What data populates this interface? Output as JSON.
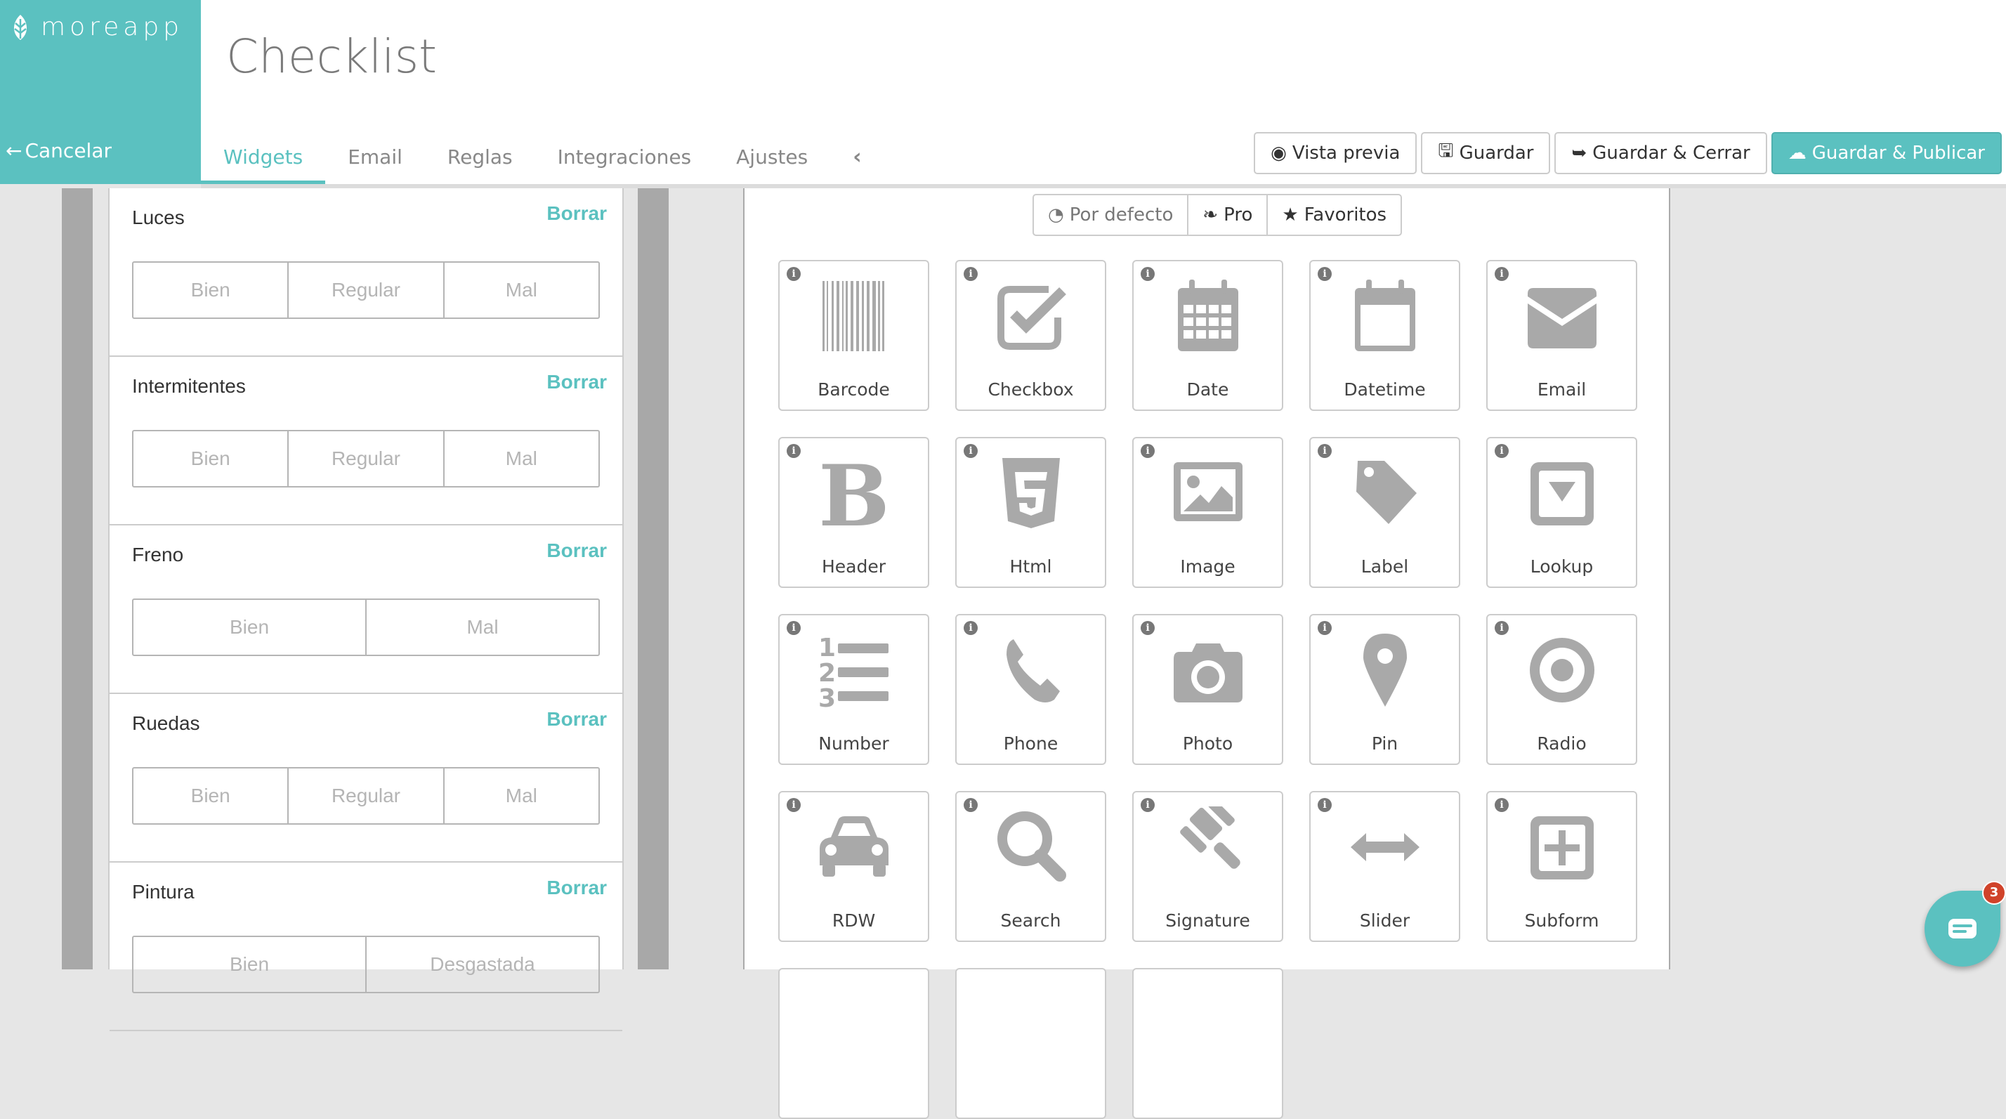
{
  "app": {
    "logo_text": "moreapp",
    "accent": "#5bc1c0",
    "cancel_label": "Cancelar"
  },
  "header": {
    "title": "Checklist",
    "tabs": [
      {
        "label": "Widgets",
        "active": true
      },
      {
        "label": "Email"
      },
      {
        "label": "Reglas"
      },
      {
        "label": "Integraciones"
      },
      {
        "label": "Ajustes"
      }
    ],
    "collapse_icon": "chevron-left-icon",
    "actions": [
      {
        "label": "Vista previa",
        "icon": "eye-icon"
      },
      {
        "label": "Guardar",
        "icon": "floppy-icon"
      },
      {
        "label": "Guardar & Cerrar",
        "icon": "sign-out-icon"
      },
      {
        "label": "Guardar & Publicar",
        "icon": "cloud-upload-icon",
        "primary": true
      }
    ]
  },
  "form_preview": {
    "clear_label": "Borrar",
    "fields": [
      {
        "label": "Luces",
        "options": [
          "Bien",
          "Regular",
          "Mal"
        ]
      },
      {
        "label": "Intermitentes",
        "options": [
          "Bien",
          "Regular",
          "Mal"
        ]
      },
      {
        "label": "Freno",
        "options": [
          "Bien",
          "Mal"
        ]
      },
      {
        "label": "Ruedas",
        "options": [
          "Bien",
          "Regular",
          "Mal"
        ]
      },
      {
        "label": "Pintura",
        "options": [
          "Bien",
          "Desgastada"
        ]
      }
    ]
  },
  "widgets": {
    "filters": [
      {
        "label": "Por defecto",
        "icon": "dashboard-icon"
      },
      {
        "label": "Pro",
        "icon": "leaf-icon"
      },
      {
        "label": "Favoritos",
        "icon": "star-icon"
      }
    ],
    "items": [
      {
        "label": "Barcode",
        "icon": "barcode-icon"
      },
      {
        "label": "Checkbox",
        "icon": "checkbox-icon"
      },
      {
        "label": "Date",
        "icon": "calendar-icon"
      },
      {
        "label": "Datetime",
        "icon": "calendar-empty-icon"
      },
      {
        "label": "Email",
        "icon": "envelope-icon"
      },
      {
        "label": "Header",
        "icon": "bold-icon"
      },
      {
        "label": "Html",
        "icon": "html5-icon"
      },
      {
        "label": "Image",
        "icon": "picture-icon"
      },
      {
        "label": "Label",
        "icon": "tag-icon"
      },
      {
        "label": "Lookup",
        "icon": "caret-square-icon"
      },
      {
        "label": "Number",
        "icon": "ordered-list-icon"
      },
      {
        "label": "Phone",
        "icon": "phone-icon"
      },
      {
        "label": "Photo",
        "icon": "camera-icon"
      },
      {
        "label": "Pin",
        "icon": "map-marker-icon"
      },
      {
        "label": "Radio",
        "icon": "dot-circle-icon"
      },
      {
        "label": "RDW",
        "icon": "car-icon"
      },
      {
        "label": "Search",
        "icon": "search-icon"
      },
      {
        "label": "Signature",
        "icon": "gavel-icon"
      },
      {
        "label": "Slider",
        "icon": "arrows-h-icon"
      },
      {
        "label": "Subform",
        "icon": "plus-square-icon"
      }
    ]
  },
  "chat": {
    "unread_count": "3"
  }
}
